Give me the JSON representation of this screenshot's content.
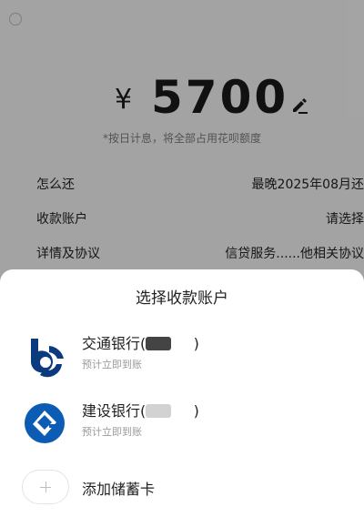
{
  "background_page": {
    "currency_symbol": "¥",
    "amount": "5700",
    "amount_note": "*按日计息，将全部占用花呗额度",
    "rows": [
      {
        "label": "怎么还",
        "value": "最晚2025年08月还"
      },
      {
        "label": "收款账户",
        "value": "请选择"
      },
      {
        "label": "详情及协议",
        "value": "信贷服务......他相关协议"
      }
    ]
  },
  "sheet": {
    "title": "选择收款账户",
    "banks": [
      {
        "name": "交通银行(",
        "close": ")",
        "subtitle": "预计立即到账",
        "logo_color": "#0b3a7e",
        "mask_color": "#444444"
      },
      {
        "name": "建设银行(",
        "close": ")",
        "subtitle": "预计立即到账",
        "logo_color": "#0d5cb3",
        "mask_color": "#cfcfcf"
      }
    ],
    "add_card_label": "添加储蓄卡"
  },
  "colors": {
    "overlay": "rgba(0,0,0,0.32)",
    "text_primary": "#222222",
    "text_secondary": "#9a9a9a"
  }
}
